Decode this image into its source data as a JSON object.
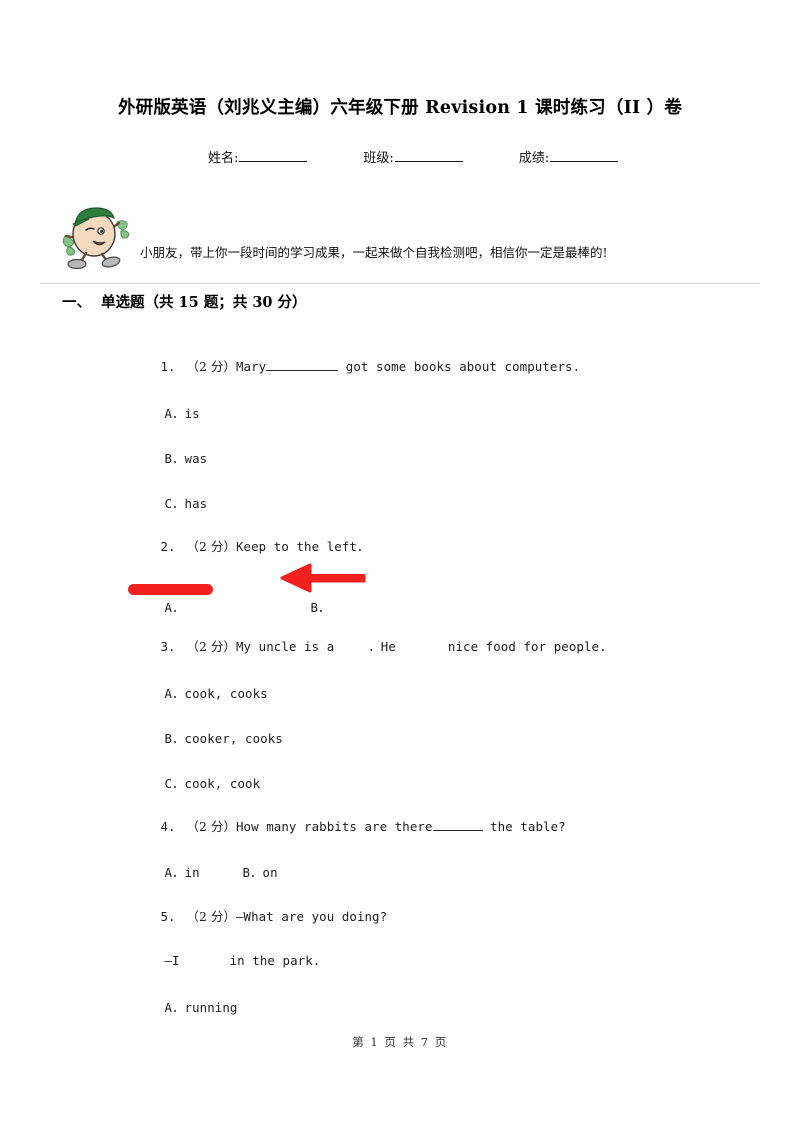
{
  "document": {
    "title": "外研版英语（刘兆义主编）六年级下册 Revision 1 课时练习（II ）卷",
    "footer": "第 1 页 共 7 页"
  },
  "identity": {
    "name_label": "姓名:",
    "class_label": "班级:",
    "score_label": "成绩:"
  },
  "intro": {
    "mascot_icon": "cartoon-student-mascot-icon",
    "text": "小朋友，带上你一段时间的学习成果，一起来做个自我检测吧，相信你一定是最棒的!"
  },
  "section": {
    "number": "一、",
    "title": "单选题（共 15 题；共 30 分）"
  },
  "colors": {
    "annotation_red": "#f32020",
    "text": "#1d1d1d",
    "rule": "#d8d8d8"
  },
  "questions": [
    {
      "index": "1.",
      "marks": "（2 分）",
      "stem_before": "Mary",
      "stem_after": " got some books about computers.",
      "options": [
        {
          "label": "A．",
          "text": "is"
        },
        {
          "label": "B．",
          "text": "was"
        },
        {
          "label": "C．",
          "text": "has"
        }
      ]
    },
    {
      "index": "2.",
      "marks": "（2 分）",
      "stem": "Keep to the left．",
      "options": [
        {
          "label": "A．",
          "text": "",
          "image": "red-horizontal-bar"
        },
        {
          "label": "B．",
          "text": "",
          "image": "red-left-arrow"
        }
      ]
    },
    {
      "index": "3.",
      "marks": "（2 分）",
      "stem_part1": "My uncle is a",
      "stem_part2": "．He",
      "stem_part3": "nice food for people.",
      "options": [
        {
          "label": "A．",
          "text": "cook, cooks"
        },
        {
          "label": "B．",
          "text": "cooker, cooks"
        },
        {
          "label": "C．",
          "text": "cook, cook"
        }
      ]
    },
    {
      "index": "4.",
      "marks": "（2 分）",
      "stem_before": "How many rabbits are there",
      "stem_after": " the table?",
      "options": [
        {
          "label": "A．",
          "text": "in"
        },
        {
          "label": "B．",
          "text": "on"
        }
      ]
    },
    {
      "index": "5.",
      "marks": "（2 分）",
      "stem": "—What are you doing?",
      "stem_line2_before": "—I",
      "stem_line2_after": "in the park.",
      "options": [
        {
          "label": "A．",
          "text": "running"
        }
      ]
    }
  ]
}
